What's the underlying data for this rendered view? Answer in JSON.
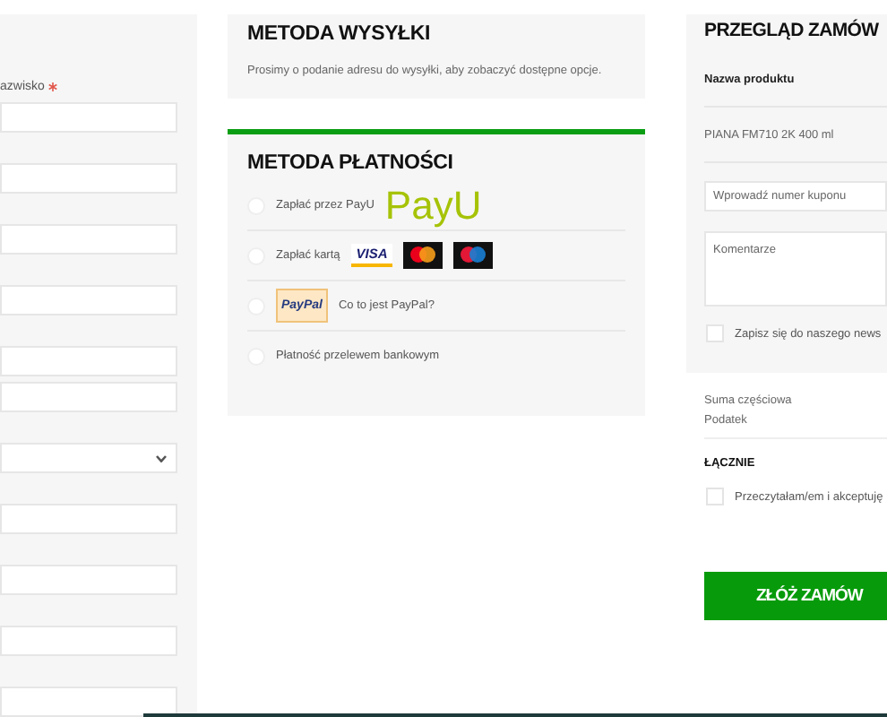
{
  "billing_form": {
    "fields": [
      {
        "kind": "text",
        "label": "azwisko",
        "required": true
      },
      {
        "kind": "text"
      },
      {
        "kind": "text"
      },
      {
        "kind": "text"
      },
      {
        "kind": "text"
      },
      {
        "kind": "text",
        "attached": true
      },
      {
        "kind": "select"
      },
      {
        "kind": "text"
      },
      {
        "kind": "text"
      },
      {
        "kind": "text"
      },
      {
        "kind": "text"
      }
    ]
  },
  "shipping": {
    "title": "METODA WYSYŁKI",
    "message": "Prosimy o podanie adresu do wysyłki, aby zobaczyć dostępne opcje."
  },
  "payment": {
    "title": "METODA PŁATNOŚCI",
    "methods": [
      {
        "kind": "payu",
        "label": "Zapłać przez PayU",
        "logo": "PayU",
        "selected": false
      },
      {
        "kind": "card",
        "label": "Zapłać kartą",
        "logo": "VISA",
        "selected": false
      },
      {
        "kind": "paypal",
        "label": "Co to jest PayPal?",
        "logo": "PayPal",
        "selected": false
      },
      {
        "kind": "transfer",
        "label": "Płatność przelewem bankowym",
        "selected": false
      }
    ]
  },
  "order_review": {
    "title": "PRZEGLĄD ZAMÓW",
    "column_header": "Nazwa produktu",
    "product": "PIANA FM710 2K 400 ml",
    "coupon": {
      "placeholder": "Wprowadź numer kuponu"
    },
    "comments": {
      "placeholder": "Komentarze"
    },
    "newsletter": {
      "label": "Zapisz się do naszego news",
      "checked": false
    },
    "subtotal_label": "Suma częściowa",
    "tax_label": "Podatek",
    "total_label": "ŁĄCZNIE",
    "terms": {
      "label": "Przeczytałam/em i akceptuję",
      "checked": false
    },
    "submit": "ZŁÓŻ ZAMÓW"
  }
}
